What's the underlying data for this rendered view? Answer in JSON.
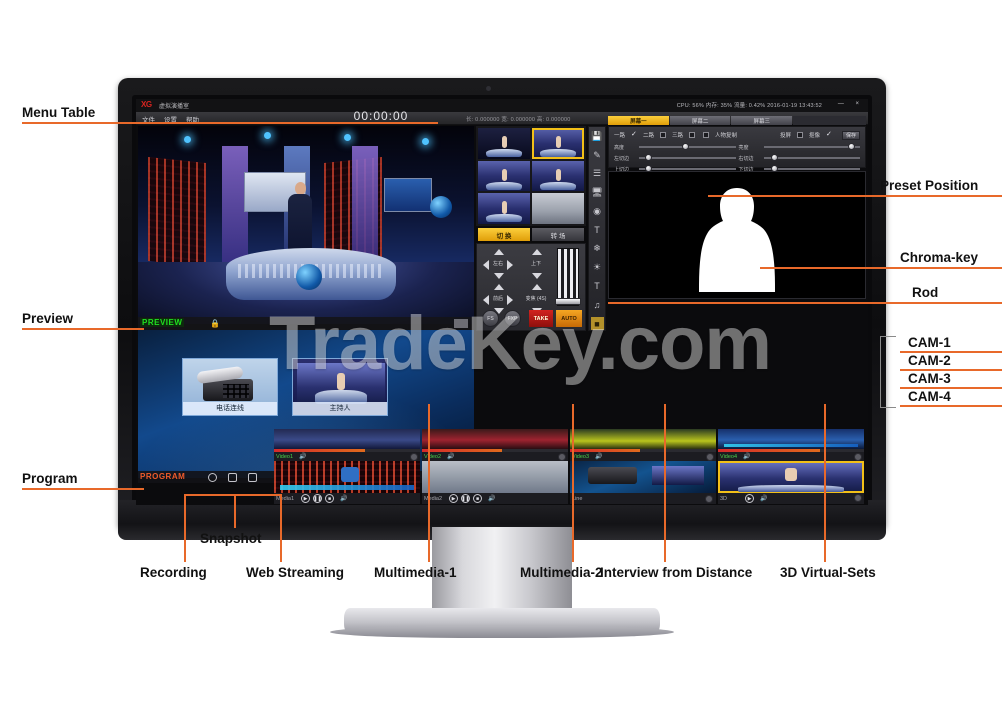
{
  "watermark": "TradeKey.com",
  "app": {
    "logo": "XG",
    "logo_cn": "虚拟演播室",
    "menu": [
      "文件",
      "设置",
      "帮助"
    ],
    "timecode": "00:00:00",
    "coords": "长: 0.000000   宽: 0.000000   高: 0.000000",
    "sysinfo": "CPU: 56%    内存: 35%    流量: 0.42%          2016-01-19 13:43:52",
    "window_buttons": "—  ×"
  },
  "preset": {
    "checkboxes": [
      {
        "label": "一路",
        "checked": true
      },
      {
        "label": "二路",
        "checked": false
      },
      {
        "label": "三路",
        "checked": false
      },
      {
        "label": "人物复制",
        "checked": false
      },
      {
        "label": "投屏",
        "checked": false
      },
      {
        "label": "抠像",
        "checked": true
      }
    ],
    "apply_button": "保存",
    "sliders": [
      {
        "label": "高度",
        "value": 45
      },
      {
        "label": "亮度",
        "value": 88
      },
      {
        "label": "左切边",
        "value": 8
      },
      {
        "label": "右切边",
        "value": 10
      },
      {
        "label": "上切边",
        "value": 8
      },
      {
        "label": "下切边",
        "value": 10
      }
    ]
  },
  "scene_tabs": [
    {
      "label": "屏幕一",
      "active": true
    },
    {
      "label": "屏幕二",
      "active": false
    },
    {
      "label": "屏幕三",
      "active": false
    }
  ],
  "scene_thumbs": [
    {
      "name": "scene-1",
      "style": "dark",
      "selected": false
    },
    {
      "name": "scene-2",
      "style": "studio",
      "selected": true
    },
    {
      "name": "scene-3",
      "style": "studio",
      "selected": false
    },
    {
      "name": "scene-4",
      "style": "studio",
      "selected": false
    },
    {
      "name": "scene-5",
      "style": "studio",
      "selected": false
    },
    {
      "name": "scene-6",
      "style": "ice",
      "selected": false
    }
  ],
  "scene_buttons": {
    "switch": "切 换",
    "transition": "转 场"
  },
  "switcher": {
    "pads": [
      {
        "label": "左右"
      },
      {
        "label": "上下"
      },
      {
        "label": "前后"
      },
      {
        "label": "变焦 (4S)"
      }
    ],
    "round_buttons": [
      "FS",
      "FXP"
    ],
    "take": "TAKE",
    "auto": "AUTO"
  },
  "toolstrip_icons": [
    "save-icon",
    "brush-icon",
    "list-icon",
    "monitor-icon",
    "target-icon",
    "text-icon",
    "flower-icon",
    "globe-icon",
    "font-icon",
    "music-icon",
    "image-icon",
    "folder-icon"
  ],
  "preview": {
    "tag": "PREVIEW",
    "lock_icon": "lock-icon"
  },
  "program": {
    "tag": "PROGRAM",
    "icons": [
      "record-icon",
      "snapshot-icon",
      "webstream-icon"
    ],
    "cards": [
      {
        "label": "电话连线"
      },
      {
        "label": "主持人"
      }
    ]
  },
  "cameras": [
    {
      "name": "Video1",
      "meter": 62
    },
    {
      "name": "Video2",
      "meter": 55
    },
    {
      "name": "Video3",
      "meter": 48
    },
    {
      "name": "Video4",
      "meter": 70
    }
  ],
  "media": [
    {
      "name": "Media1",
      "controls": [
        "play",
        "pause",
        "stop",
        "volume"
      ],
      "selected": false
    },
    {
      "name": "Media2",
      "controls": [
        "play",
        "pause",
        "stop",
        "volume"
      ],
      "selected": false
    },
    {
      "name": "Line",
      "controls": [
        "volume"
      ],
      "selected": false
    },
    {
      "name": "3D",
      "controls": [
        "play",
        "volume"
      ],
      "selected": true
    }
  ],
  "annotations": {
    "left": [
      {
        "id": "menu-table",
        "text": "Menu Table"
      },
      {
        "id": "preview",
        "text": "Preview"
      },
      {
        "id": "program",
        "text": "Program"
      }
    ],
    "right": [
      {
        "id": "preset-position",
        "text": "Preset Position"
      },
      {
        "id": "chroma-key",
        "text": "Chroma-key"
      },
      {
        "id": "rod",
        "text": "Rod"
      },
      {
        "id": "cam-1",
        "text": "CAM-1"
      },
      {
        "id": "cam-2",
        "text": "CAM-2"
      },
      {
        "id": "cam-3",
        "text": "CAM-3"
      },
      {
        "id": "cam-4",
        "text": "CAM-4"
      }
    ],
    "bottom": [
      {
        "id": "snapshot",
        "text": "Snapshot"
      },
      {
        "id": "recording",
        "text": "Recording"
      },
      {
        "id": "web-streaming",
        "text": "Web Streaming"
      },
      {
        "id": "multimedia-1",
        "text": "Multimedia-1"
      },
      {
        "id": "multimedia-2",
        "text": "Multimedia-2"
      },
      {
        "id": "interview-from-distance",
        "text": "Interview from Distance"
      },
      {
        "id": "3d-virtual-sets",
        "text": "3D Virtual-Sets"
      }
    ]
  },
  "colors": {
    "accent_orange": "#e8692a",
    "highlight_yellow": "#f2c018",
    "preview_green": "#4ad24a",
    "program_red": "#ef5a2a",
    "take_red": "#d2231f"
  }
}
